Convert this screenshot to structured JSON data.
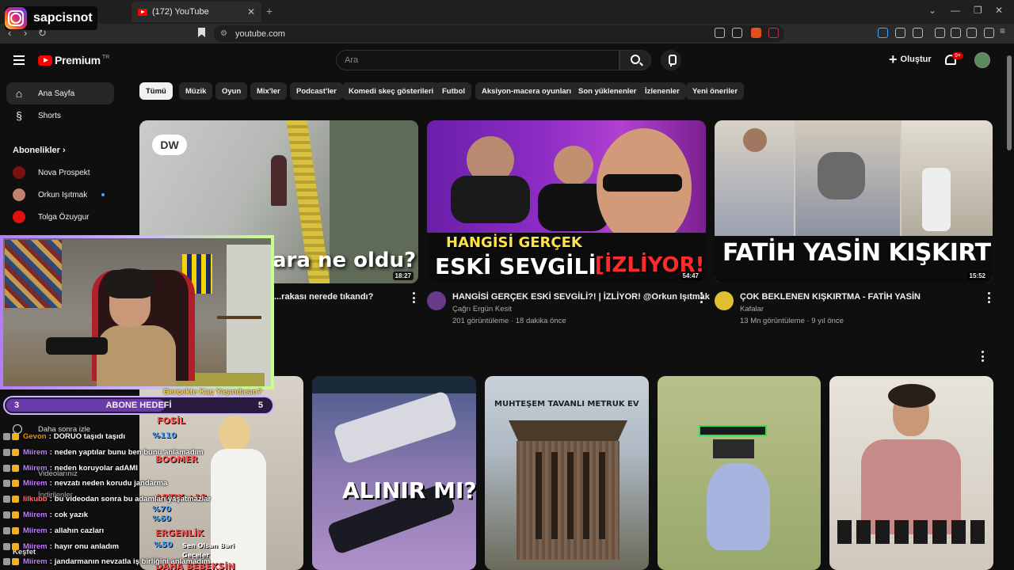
{
  "browser": {
    "tab_title": "(172) YouTube",
    "url": "youtube.com"
  },
  "overlay": {
    "instagram_handle": "sapcisnot",
    "goal_question": "Gerçekte Kaç Yaşındasın?",
    "goal_current": "3",
    "goal_label": "ABONE HEDEFİ",
    "goal_target": "5",
    "goal_fraction": 0.6
  },
  "youtube": {
    "logo_text": "Premium",
    "logo_region": "TR",
    "search_placeholder": "Ara",
    "create_label": "Oluştur",
    "notification_count": "9+"
  },
  "sidebar": {
    "home": "Ana Sayfa",
    "shorts": "Shorts",
    "subscriptions_head": "Abonelikler",
    "subscriptions": [
      {
        "name": "Nova Prospekt",
        "color": "#d02020"
      },
      {
        "name": "Orkun Işıtmak",
        "color": "#d05050"
      },
      {
        "name": "Tolga Özuygur",
        "color": "#e01010"
      }
    ],
    "watch_later": "Daha sonra izle",
    "your_videos": "Videolarınız",
    "downloads": "İndirilenler",
    "explore": "Keşfet"
  },
  "chips": [
    "Tümü",
    "Müzik",
    "Oyun",
    "Mix'ler",
    "Podcast'ler",
    "Komedi skeç gösterileri",
    "Futbol",
    "Aksiyon-macera oyunları",
    "Son yüklenenler",
    "İzlenenler",
    "Yeni öneriler"
  ],
  "videos_row1": [
    {
      "title": "...rakası nerede tıkandı?",
      "duration": "18:27",
      "thumb_text": "ara ne oldu?",
      "logo": "DW"
    },
    {
      "title": "HANGİSİ GERÇEK ESKİ SEVGİLİ?! | İZLİYOR! @Orkun Işıtmak",
      "channel": "Çağrı Ergün Kesit",
      "meta": "201 görüntüleme · 18 dakika önce",
      "duration": "54:47",
      "thumb_text_1": "HANGİSİ GERÇEK",
      "thumb_text_2": "ESKİ SEVGİLİ",
      "thumb_text_3": "[İZLİYOR!]"
    },
    {
      "title": "ÇOK BEKLENEN KIŞKIRTMA - FATİH YASİN",
      "channel": "Kafalar",
      "meta": "13 Mn görüntüleme · 9 yıl önce",
      "duration": "15:52",
      "thumb_text": "FATİH YASİN KIŞKIRTMA"
    }
  ],
  "videos_row2": [
    {
      "thumb_text": ""
    },
    {
      "thumb_text": "ALINIR MI?"
    },
    {
      "thumb_text": "MUHTEŞEM TAVANLI METRUK EV"
    },
    {
      "thumb_text": ""
    },
    {
      "thumb_text": ""
    }
  ],
  "tierlist": [
    "FOSİL",
    "%110",
    "BOOMER",
    "ARTIK +18",
    "%70",
    "%60",
    "ERGENLİK",
    "%50",
    "Sen Olsan Bari",
    "Geceler",
    "DAHA BEBEKSİN"
  ],
  "chat": [
    {
      "user": "Gevon",
      "msg": "DORUO taşıdı taşıdı",
      "color": "#ff8c00"
    },
    {
      "user": "Miirem",
      "msg": "neden yaptılar bunu ben bunu anlamadım",
      "color": "#c080ff"
    },
    {
      "user": "Miirem",
      "msg": "neden koruyolar adAMI",
      "color": "#c080ff"
    },
    {
      "user": "Miirem",
      "msg": "nevzatı neden korudu jandarma",
      "color": "#c080ff"
    },
    {
      "user": "lilkubb",
      "msg": "bu videodan sonra bu adamları yaşatmazlar",
      "color": "#ff7070"
    },
    {
      "user": "Miirem",
      "msg": "cok yazık",
      "color": "#c080ff"
    },
    {
      "user": "Miirem",
      "msg": "allahın cazları",
      "color": "#c080ff"
    },
    {
      "user": "Miirem",
      "msg": "hayır onu anladım",
      "color": "#c080ff"
    },
    {
      "user": "Miirem",
      "msg": "jandarmanın nevzatla iş birliğini anlamadım",
      "color": "#c080ff"
    }
  ]
}
